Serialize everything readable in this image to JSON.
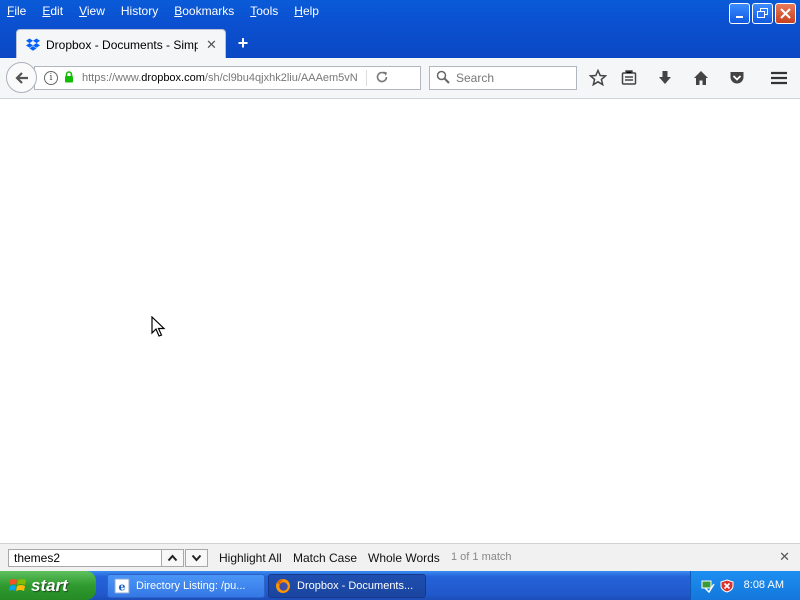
{
  "menubar": {
    "items": [
      {
        "label": "File",
        "accel": "F",
        "rest": "ile"
      },
      {
        "label": "Edit",
        "accel": "E",
        "rest": "dit"
      },
      {
        "label": "View",
        "accel": "V",
        "rest": "iew"
      },
      {
        "label": "History",
        "accel": "H",
        "rest": "istory"
      },
      {
        "label": "Bookmarks",
        "accel": "B",
        "rest": "ookmarks"
      },
      {
        "label": "Tools",
        "accel": "T",
        "rest": "ools"
      },
      {
        "label": "Help",
        "accel": "H",
        "rest": "elp"
      }
    ]
  },
  "tab": {
    "title": "Dropbox - Documents - Simpli…",
    "close": "✕"
  },
  "newtab": {
    "label": "+"
  },
  "urlbar": {
    "prefix": "https://www.",
    "domain": "dropbox.com",
    "path": "/sh/cl9bu4qjxhk2liu/AAAem5vN"
  },
  "search": {
    "placeholder": "Search"
  },
  "findbar": {
    "query": "themes2",
    "highlight_all": "Highlight All",
    "highlight_all_accel": "A",
    "match_case": "Match Case",
    "match_case_accel": "C",
    "whole_words": "Whole Words",
    "whole_words_accel": "W",
    "status": "1 of 1 match",
    "close": "✕"
  },
  "taskbar": {
    "start_label": "start",
    "tasks": [
      {
        "label": "Directory Listing: /pu..."
      },
      {
        "label": "Dropbox - Documents..."
      }
    ],
    "clock": "8:08 AM"
  },
  "colors": {
    "titlebar": "#0b50d0",
    "taskbar": "#2158cc",
    "start_green": "#2f9a2f",
    "dropbox_blue": "#0061fe",
    "lock_green": "#12bc00"
  }
}
